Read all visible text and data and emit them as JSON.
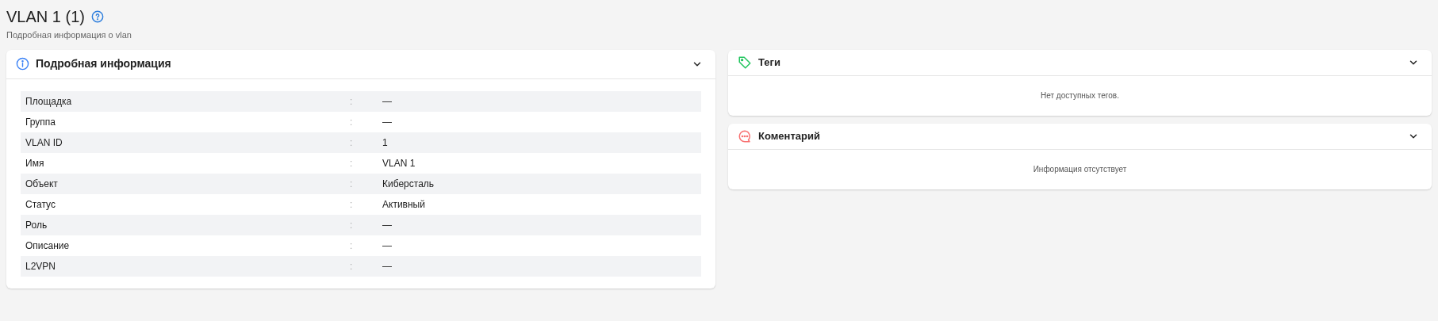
{
  "page": {
    "title": "VLAN 1 (1)",
    "subtitle": "Подробная информация о vlan"
  },
  "details": {
    "title": "Подробная информация",
    "rows": [
      {
        "label": "Площадка",
        "separator": ":",
        "value": "—"
      },
      {
        "label": "Группа",
        "separator": ":",
        "value": "—"
      },
      {
        "label": "VLAN ID",
        "separator": ":",
        "value": "1"
      },
      {
        "label": "Имя",
        "separator": ":",
        "value": "VLAN 1"
      },
      {
        "label": "Объект",
        "separator": ":",
        "value": "Киберсталь"
      },
      {
        "label": "Статус",
        "separator": ":",
        "value": "Активный"
      },
      {
        "label": "Роль",
        "separator": ":",
        "value": "—"
      },
      {
        "label": "Описание",
        "separator": ":",
        "value": "—"
      },
      {
        "label": "L2VPN",
        "separator": ":",
        "value": "—"
      }
    ]
  },
  "panels": [
    {
      "kind": "tags",
      "title": "Теги",
      "empty_text": "Нет доступных тегов."
    },
    {
      "kind": "comments",
      "title": "Коментарий",
      "empty_text": "Информация отсутствует"
    }
  ]
}
